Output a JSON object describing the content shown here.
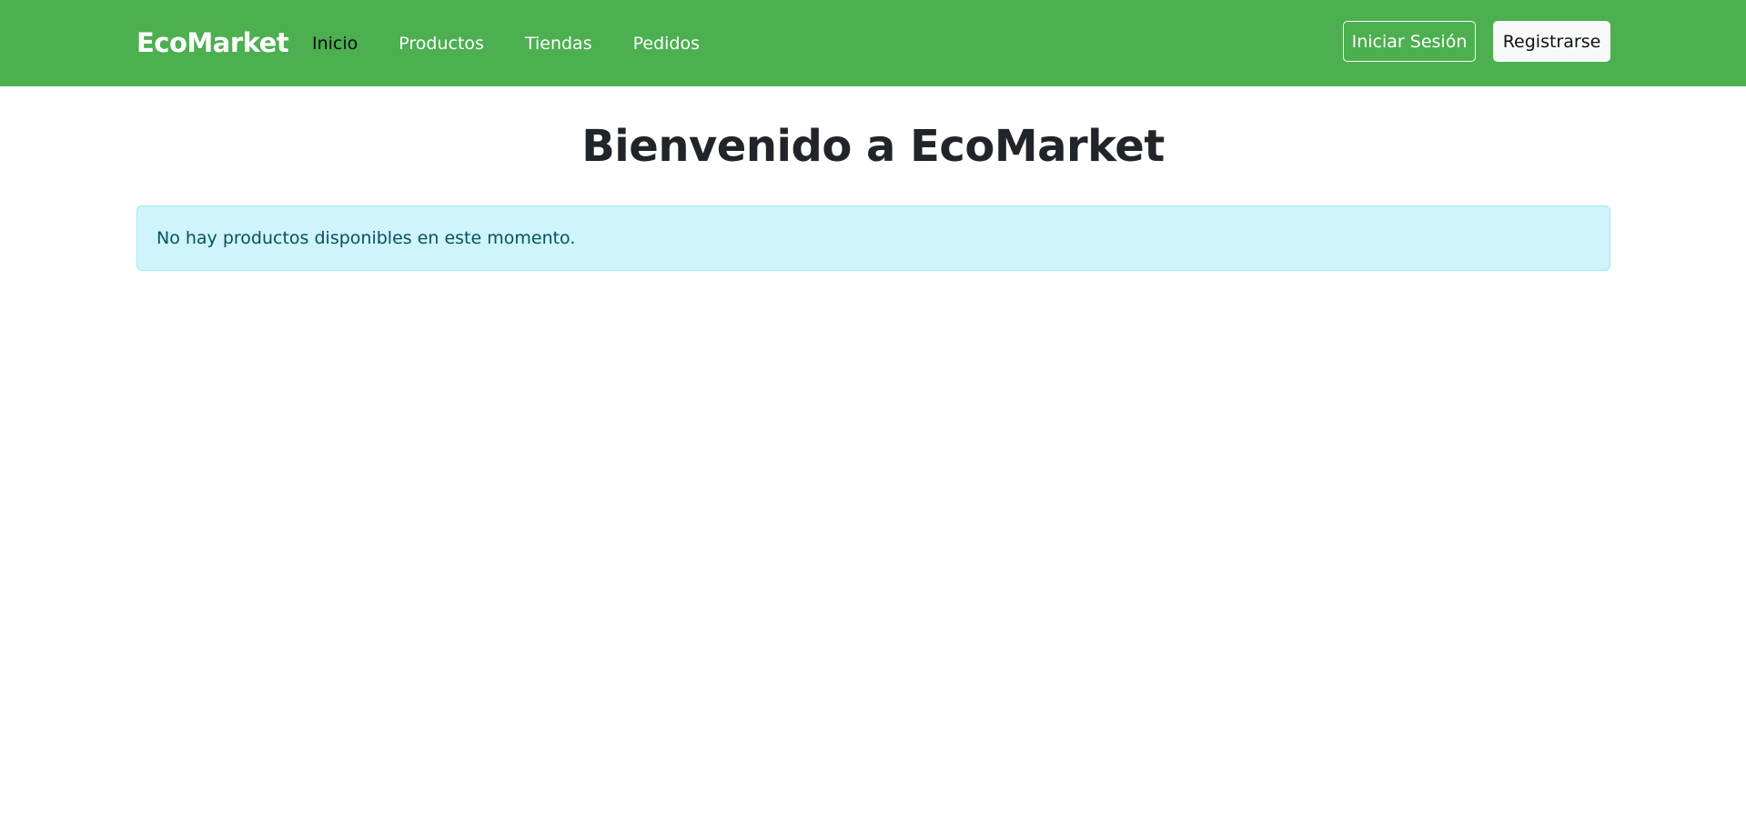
{
  "navbar": {
    "brand": "EcoMarket",
    "links": [
      {
        "label": "Inicio",
        "active": true
      },
      {
        "label": "Productos",
        "active": false
      },
      {
        "label": "Tiendas",
        "active": false
      },
      {
        "label": "Pedidos",
        "active": false
      }
    ],
    "login_label": "Iniciar Sesión",
    "register_label": "Registrarse"
  },
  "main": {
    "title": "Bienvenido a EcoMarket",
    "alert_text": "No hay productos disponibles en este momento."
  },
  "colors": {
    "navbar_bg": "#4caf50",
    "alert_bg": "#cff4fc",
    "alert_border": "#9eeaf9",
    "alert_text": "#055160"
  }
}
